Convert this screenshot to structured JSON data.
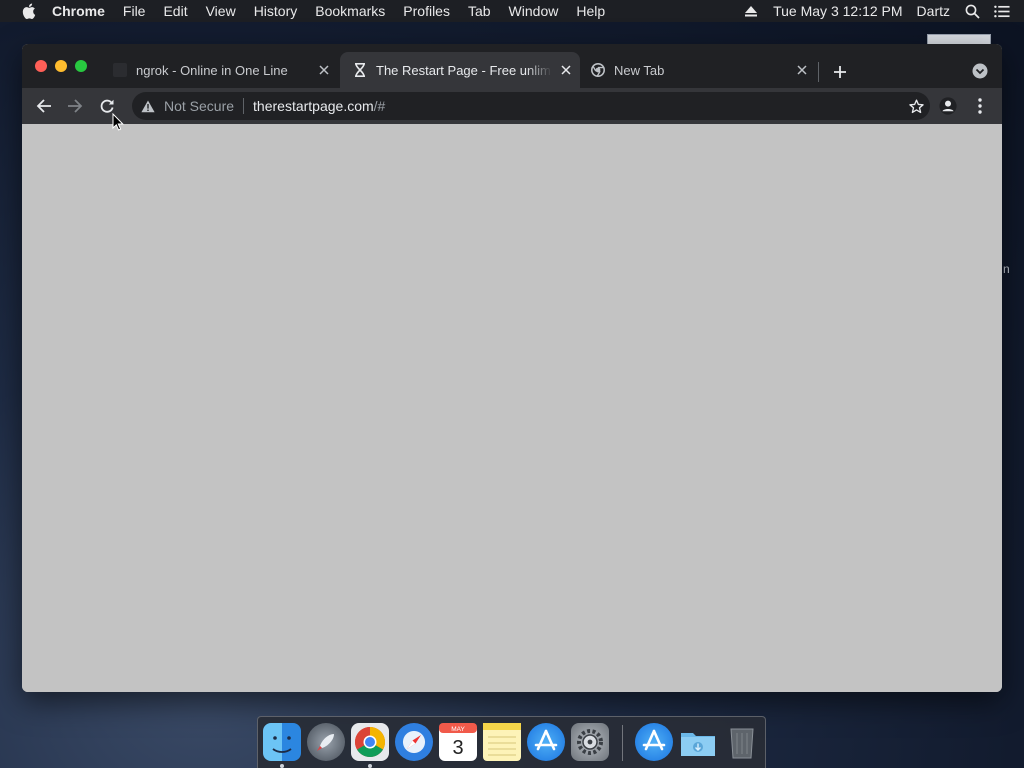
{
  "menubar": {
    "app_name": "Chrome",
    "menus": [
      "File",
      "Edit",
      "View",
      "History",
      "Bookmarks",
      "Profiles",
      "Tab",
      "Window",
      "Help"
    ],
    "datetime": "Tue May 3  12:12 PM",
    "user": "Dartz"
  },
  "desktop": {
    "fragment": "n"
  },
  "browser": {
    "tabs": [
      {
        "title": "ngrok - Online in One Line",
        "icon": "ngrok-favicon",
        "active": false
      },
      {
        "title": "The Restart Page - Free unlimited",
        "icon": "hourglass-icon",
        "active": true
      },
      {
        "title": "New Tab",
        "icon": "chrome-icon",
        "active": false
      }
    ],
    "omnibox": {
      "security_label": "Not Secure",
      "url_host": "therestartpage.com",
      "url_path": "/#"
    }
  },
  "dock": {
    "apps": [
      "Finder",
      "Launchpad",
      "Google Chrome",
      "Safari",
      "Calendar",
      "Notes",
      "App Store",
      "System Preferences",
      "App Store",
      "Downloads",
      "Trash"
    ],
    "calendar": {
      "month": "MAY",
      "day": "3"
    }
  },
  "colors": {
    "menubar_bg": "#1d1f24",
    "tabstrip_bg": "#202124",
    "active_tab_bg": "#35363a",
    "content_bg": "#c3c3c3"
  }
}
